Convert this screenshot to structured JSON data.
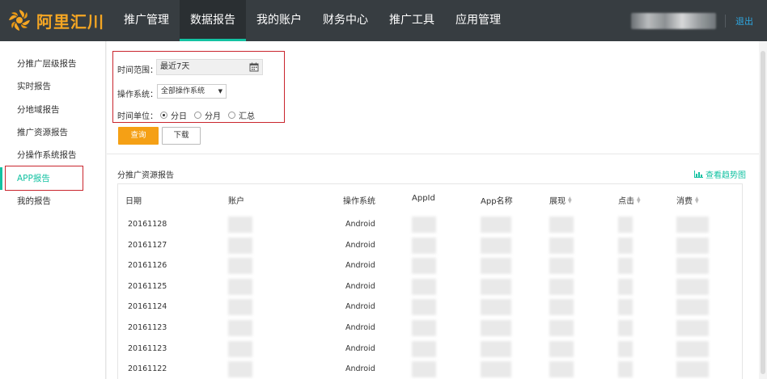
{
  "brand": {
    "name": "阿里汇川",
    "color": "#f5a623"
  },
  "nav": {
    "items": [
      {
        "label": "推广管理",
        "active": false
      },
      {
        "label": "数据报告",
        "active": true
      },
      {
        "label": "我的账户",
        "active": false
      },
      {
        "label": "财务中心",
        "active": false
      },
      {
        "label": "推广工具",
        "active": false
      },
      {
        "label": "应用管理",
        "active": false
      }
    ],
    "logout": "退出"
  },
  "sidebar": {
    "items": [
      {
        "label": "分推广层级报告"
      },
      {
        "label": "实时报告"
      },
      {
        "label": "分地域报告"
      },
      {
        "label": "推广资源报告"
      },
      {
        "label": "分操作系统报告"
      },
      {
        "label": "APP报告",
        "active": true
      },
      {
        "label": "我的报告"
      }
    ]
  },
  "filter": {
    "time_range_label": "时间范围：",
    "time_range_value": "最近7天",
    "os_label": "操作系统：",
    "os_value": "全部操作系统",
    "unit_label": "时间单位：",
    "unit_options": [
      "分日",
      "分月",
      "汇总"
    ],
    "unit_selected": "分日",
    "query_button": "查询",
    "download_button": "下载"
  },
  "report": {
    "title": "分推广资源报告",
    "trend_link": "查看趋势图",
    "columns": [
      "日期",
      "账户",
      "操作系统",
      "AppId",
      "App名称",
      "展现",
      "点击",
      "消费"
    ],
    "rows": [
      {
        "date": "20161128",
        "os": "Android"
      },
      {
        "date": "20161127",
        "os": "Android"
      },
      {
        "date": "20161126",
        "os": "Android"
      },
      {
        "date": "20161125",
        "os": "Android"
      },
      {
        "date": "20161124",
        "os": "Android"
      },
      {
        "date": "20161123",
        "os": "Android"
      },
      {
        "date": "20161123",
        "os": "Android"
      },
      {
        "date": "20161122",
        "os": "Android"
      }
    ]
  },
  "colors": {
    "accent": "#13c2a2",
    "primary_button": "#f5a015",
    "highlight_box": "#c9252d",
    "topbar": "#373d41"
  }
}
